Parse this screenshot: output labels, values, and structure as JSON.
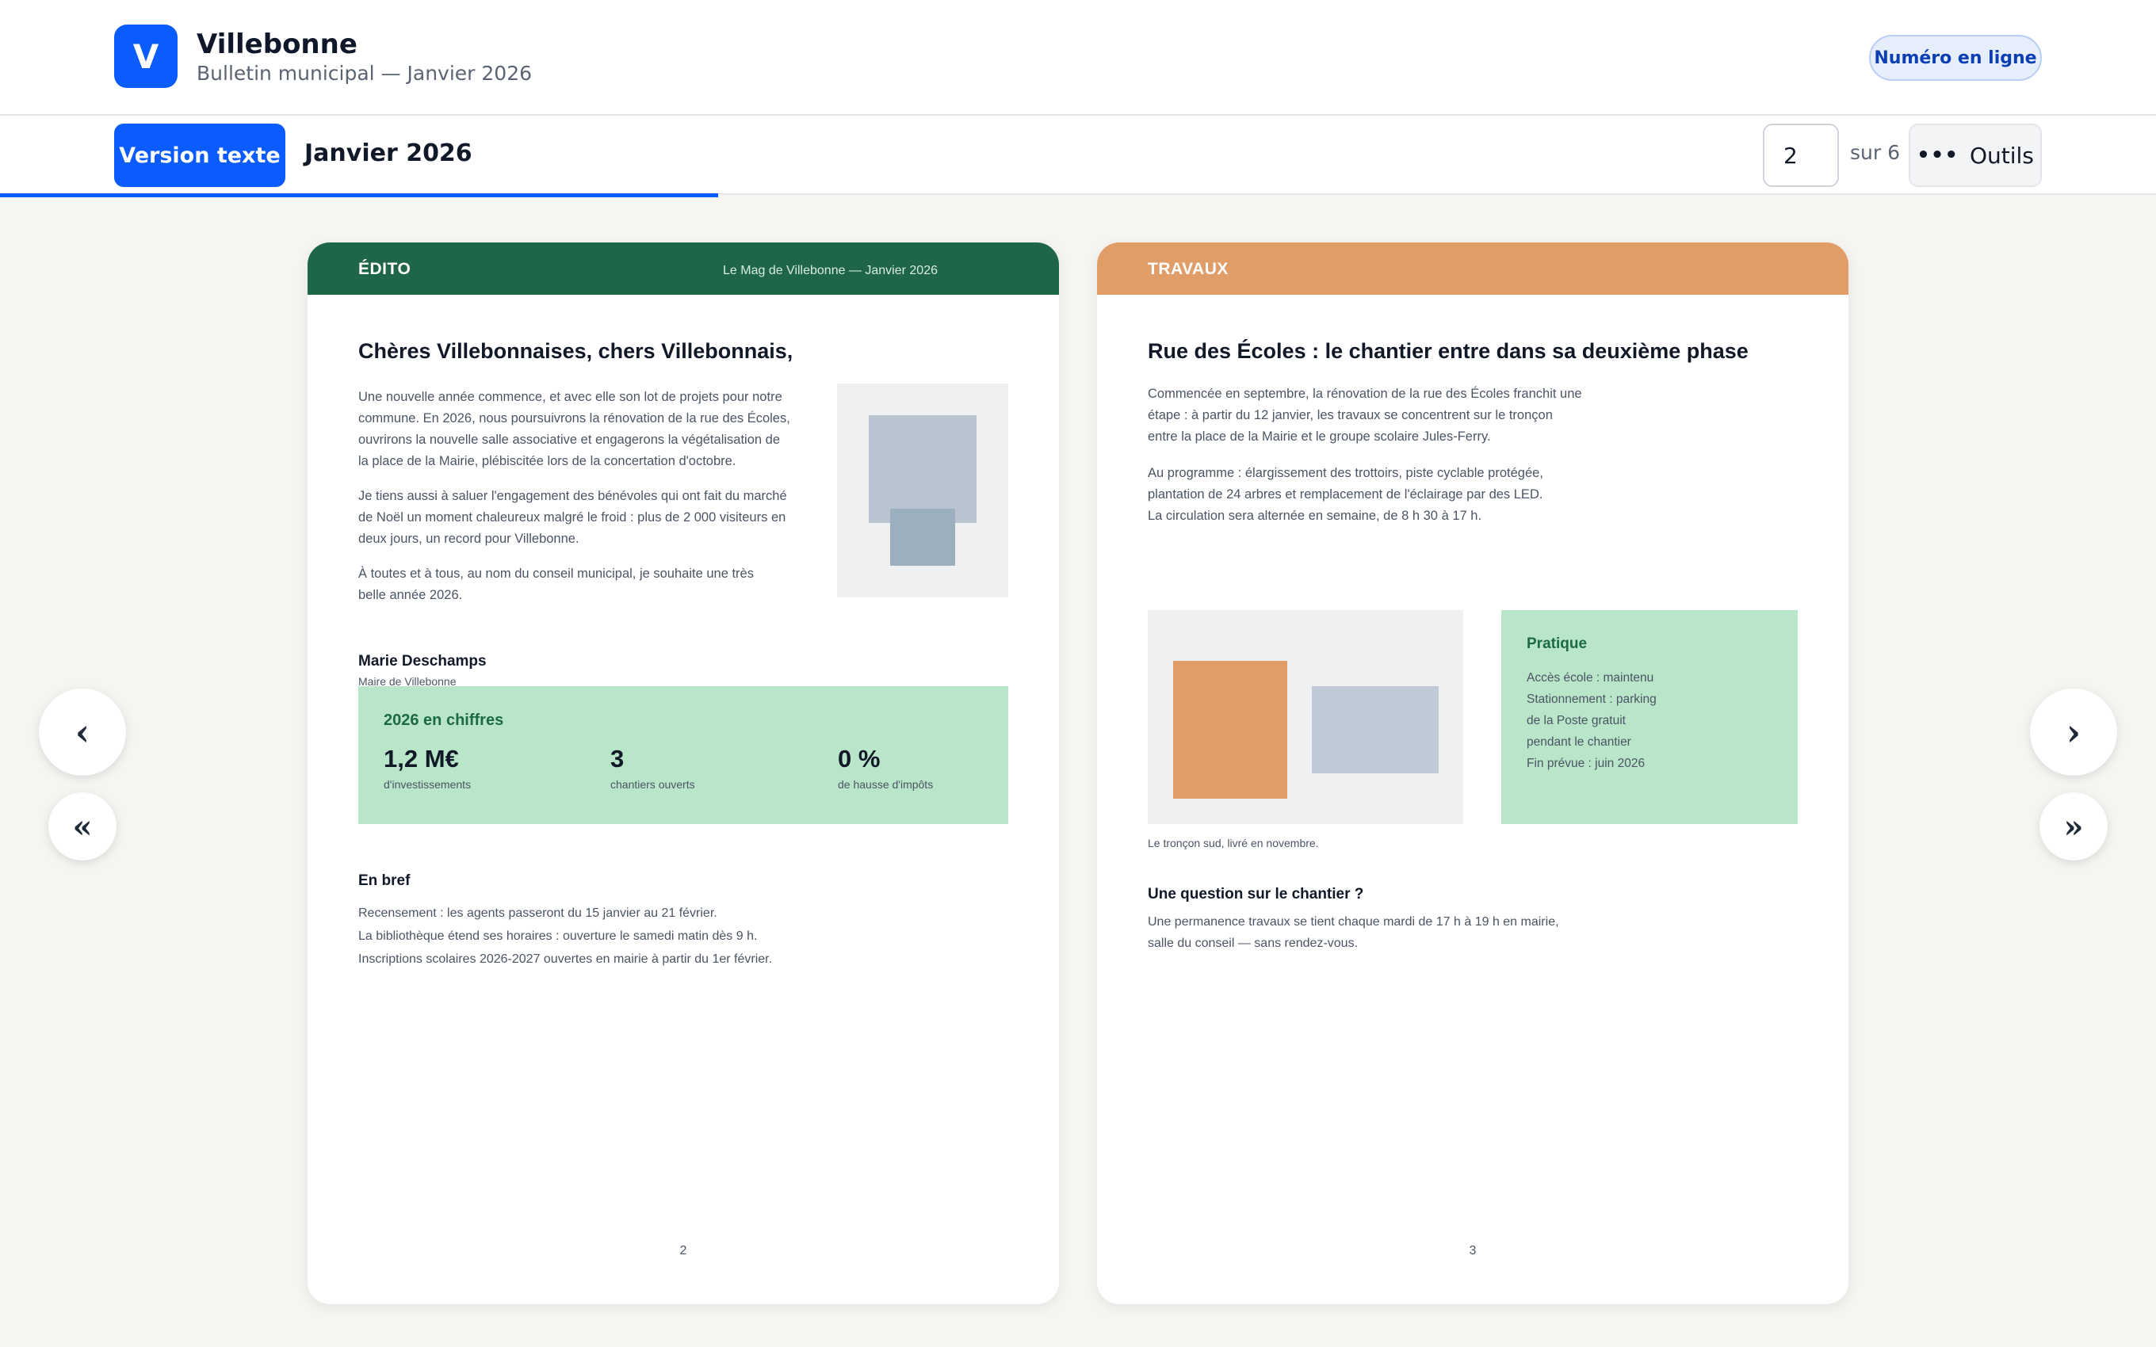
{
  "header": {
    "logo_letter": "V",
    "app_title": "Villebonne",
    "subtitle": "Bulletin municipal — Janvier 2026",
    "online_button": "Numéro en ligne"
  },
  "toolbar": {
    "text_version_button": "Version texte",
    "issue_title": "Janvier 2026",
    "current_page": "2",
    "page_total": "sur 6",
    "tools_button": "Outils",
    "reading_progress": 0.333
  },
  "nav": {
    "prev": "‹",
    "first": "«",
    "next": "›",
    "last": "»"
  },
  "left_page": {
    "section": "ÉDITO",
    "magazine": "Le Mag de Villebonne — Janvier 2026",
    "title": "Chères Villebonnaises, chers Villebonnais,",
    "paragraphs": [
      [
        "Une nouvelle année commence, et avec elle son lot de projets pour notre",
        "commune. En 2026, nous poursuivrons la rénovation de la rue des Écoles,",
        "ouvrirons la nouvelle salle associative et engagerons la végétalisation de",
        "la place de la Mairie, plébiscitée lors de la concertation d'octobre."
      ],
      [
        "Je tiens aussi à saluer l'engagement des bénévoles qui ont fait du marché",
        "de Noël un moment chaleureux malgré le froid : plus de 2 000 visiteurs en",
        "deux jours, un record pour Villebonne."
      ],
      [
        "À toutes et à tous, au nom du conseil municipal, je souhaite une très",
        "belle année 2026."
      ]
    ],
    "signature_name": "Marie Deschamps",
    "signature_role": "Maire de Villebonne",
    "stats": {
      "title": "2026 en chiffres",
      "items": [
        {
          "value": "1,2 M€",
          "label": "d'investissements"
        },
        {
          "value": "3",
          "label": "chantiers ouverts"
        },
        {
          "value": "0 %",
          "label": "de hausse d'impôts"
        }
      ]
    },
    "brief": {
      "title": "En bref",
      "lines": [
        "Recensement : les agents passeront du 15 janvier au 21 février.",
        "La bibliothèque étend ses horaires : ouverture le samedi matin dès 9 h.",
        "Inscriptions scolaires 2026-2027 ouvertes en mairie à partir du 1er février."
      ]
    },
    "page_number": "2",
    "colors": {
      "header": "#1e6647",
      "panel": "#b9e5c9"
    }
  },
  "right_page": {
    "section": "TRAVAUX",
    "title": "Rue des Écoles : le chantier entre dans sa deuxième phase",
    "paragraphs": [
      [
        "Commencée en septembre, la rénovation de la rue des Écoles franchit une",
        "étape : à partir du 12 janvier, les travaux se concentrent sur le tronçon",
        "entre la place de la Mairie et le groupe scolaire Jules-Ferry."
      ],
      [
        "Au programme : élargissement des trottoirs, piste cyclable protégée,",
        "plantation de 24 arbres et remplacement de l'éclairage par des LED.",
        "La circulation sera alternée en semaine, de 8 h 30 à 17 h."
      ]
    ],
    "caption": "Le tronçon sud, livré en novembre.",
    "practical": {
      "title": "Pratique",
      "lines": [
        "Accès école : maintenu",
        "Stationnement : parking",
        "de la Poste gratuit",
        "pendant le chantier",
        "Fin prévue : juin 2026"
      ]
    },
    "question": {
      "title": "Une question sur le chantier ?",
      "lines": [
        "Une permanence travaux se tient chaque mardi de 17 h à 19 h en mairie,",
        "salle du conseil — sans rendez-vous."
      ]
    },
    "page_number": "3",
    "colors": {
      "header": "#e09d68"
    }
  }
}
